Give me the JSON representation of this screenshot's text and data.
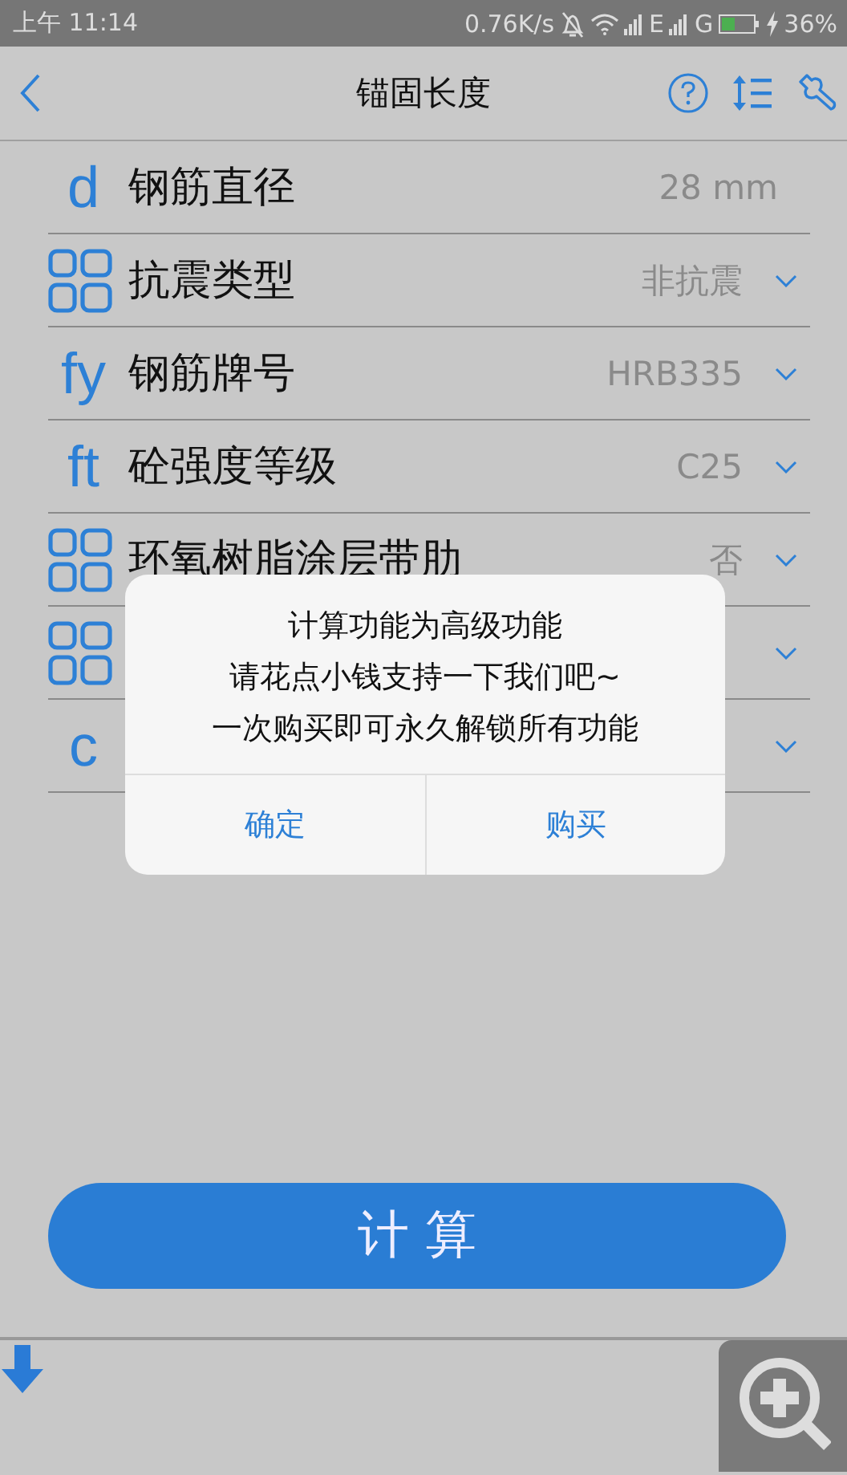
{
  "status_bar": {
    "time": "上午 11:14",
    "speed": "0.76K/s",
    "signal_1": "E",
    "signal_2": "G",
    "battery": "36%"
  },
  "nav": {
    "title": "锚固长度"
  },
  "rows": [
    {
      "icon": {
        "kind": "letter",
        "text": "d"
      },
      "label": "钢筋直径",
      "value": "28 mm",
      "kind": "input"
    },
    {
      "icon": {
        "kind": "grid"
      },
      "label": "抗震类型",
      "value": "非抗震",
      "kind": "select"
    },
    {
      "icon": {
        "kind": "letter",
        "text": "fy"
      },
      "label": "钢筋牌号",
      "value": "HRB335",
      "kind": "select"
    },
    {
      "icon": {
        "kind": "letter",
        "text": "ft"
      },
      "label": "砼强度等级",
      "value": "C25",
      "kind": "select"
    },
    {
      "icon": {
        "kind": "grid"
      },
      "label": "环氧树脂涂层带肋",
      "value": "否",
      "kind": "select"
    },
    {
      "icon": {
        "kind": "grid"
      },
      "kind": "select"
    },
    {
      "icon": {
        "kind": "letter",
        "text": "c"
      },
      "kind": "select"
    }
  ],
  "calculate_button": "计 算",
  "dialog": {
    "lines": [
      "计算功能为高级功能",
      "请花点小钱支持一下我们吧~",
      "一次购买即可永久解锁所有功能"
    ],
    "buttons": [
      "确定",
      "购买"
    ]
  }
}
